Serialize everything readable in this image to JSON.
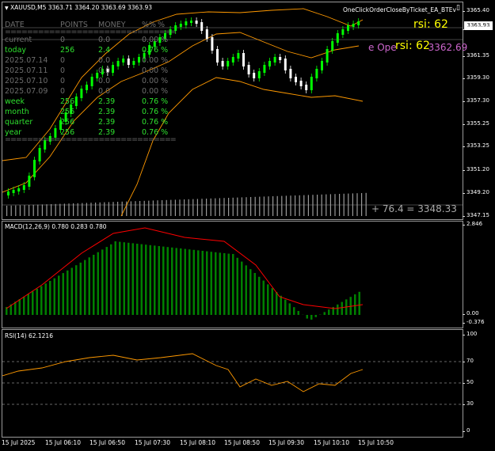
{
  "chart": {
    "symbol_line": "XAUUSD,M5  3363.71 3364.20 3363.69 3363.93",
    "ea_name": "OneClickOrderCloseByTicket_EA_BTEv",
    "rsi_label_1": "rsi: 62",
    "rsi_label_2": "rsi: 62",
    "open_label": "e Ope",
    "open_value": "3362.69",
    "current_price": "3363.93",
    "line_readout": "+ 76.4  = 3348.33",
    "colors": {
      "bull_candle": "#00ff00",
      "bear_candle": "#ffffff",
      "bands": "#ff9900",
      "macd_hist": "#008000",
      "signal": "#ff0000",
      "rsi": "#ff9900",
      "text_yellow": "#ffff00",
      "text_magenta": "#cc66cc",
      "stats_green": "#2ee02e",
      "stats_gray": "#6d6d6d"
    }
  },
  "stats_table": {
    "headers": [
      "DATE",
      "POINTS",
      "MONEY",
      "%%",
      "%"
    ],
    "rows": [
      {
        "label": "current",
        "points": "0",
        "money": "0.0",
        "pct": "0.00 %",
        "tone": "gray"
      },
      {
        "label": "today",
        "points": "256",
        "money": "2.4",
        "pct": "0.76 %",
        "tone": "green"
      },
      {
        "label": "2025.07.14",
        "points": "0",
        "money": "0.0",
        "pct": "0.00 %",
        "tone": "gray"
      },
      {
        "label": "2025.07.11",
        "points": "0",
        "money": "0.0",
        "pct": "0.00 %",
        "tone": "gray"
      },
      {
        "label": "2025.07.10",
        "points": "0",
        "money": "0.0",
        "pct": "0.00 %",
        "tone": "gray"
      },
      {
        "label": "2025.07.09",
        "points": "0",
        "money": "0.0",
        "pct": "0.00 %",
        "tone": "gray"
      },
      {
        "label": "week",
        "points": "256",
        "money": "2.39",
        "pct": "0.76 %",
        "tone": "green"
      },
      {
        "label": "month",
        "points": "256",
        "money": "2.39",
        "pct": "0.76 %",
        "tone": "green"
      },
      {
        "label": "quarter",
        "points": "256",
        "money": "2.39",
        "pct": "0.76 %",
        "tone": "green"
      },
      {
        "label": "year",
        "points": "256",
        "money": "2.39",
        "pct": "0.76 %",
        "tone": "green"
      }
    ]
  },
  "price_axis": [
    "3365.40",
    "3363.93",
    "3361.35",
    "3359.30",
    "3357.30",
    "3355.25",
    "3353.25",
    "3351.20",
    "3349.20",
    "3347.15"
  ],
  "macd": {
    "title": "MACD(12,26,9) 0.780 0.283 0.780",
    "axis": [
      "2.846",
      "0.00",
      "-0.376"
    ]
  },
  "rsi": {
    "title": "RSI(14) 62.1216",
    "axis": [
      "100",
      "70",
      "50",
      "30",
      "0"
    ]
  },
  "time_axis": [
    "15 Jul 2025",
    "15 Jul 06:10",
    "15 Jul 06:50",
    "15 Jul 07:30",
    "15 Jul 08:10",
    "15 Jul 08:50",
    "15 Jul 09:30",
    "15 Jul 10:10",
    "15 Jul 10:50"
  ]
}
